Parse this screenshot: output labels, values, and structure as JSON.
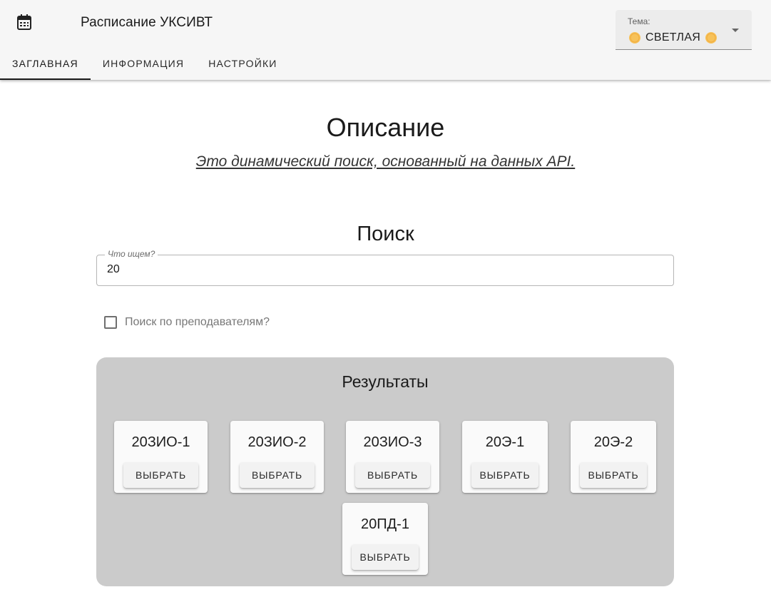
{
  "app": {
    "title": "Расписание УКСИВТ",
    "icon": "calendar-icon"
  },
  "tabs": [
    {
      "label": "Заглавная",
      "active": true
    },
    {
      "label": "Информация",
      "active": false
    },
    {
      "label": "Настройки",
      "active": false
    }
  ],
  "theme": {
    "label": "Тема:",
    "value": "СВЕТЛАЯ"
  },
  "description": {
    "title": "Описание",
    "text": "Это динамический поиск, основанный на данных API."
  },
  "search": {
    "title": "Поиск",
    "label": "Что ищем?",
    "value": "20",
    "teacher_checkbox_label": "Поиск по преподавателям?",
    "teacher_checked": false
  },
  "results": {
    "title": "Результаты",
    "button_label": "Выбрать",
    "items": [
      "20ЗИО-1",
      "20ЗИО-2",
      "20ЗИО-3",
      "20Э-1",
      "20Э-2",
      "20ПД-1"
    ]
  }
}
